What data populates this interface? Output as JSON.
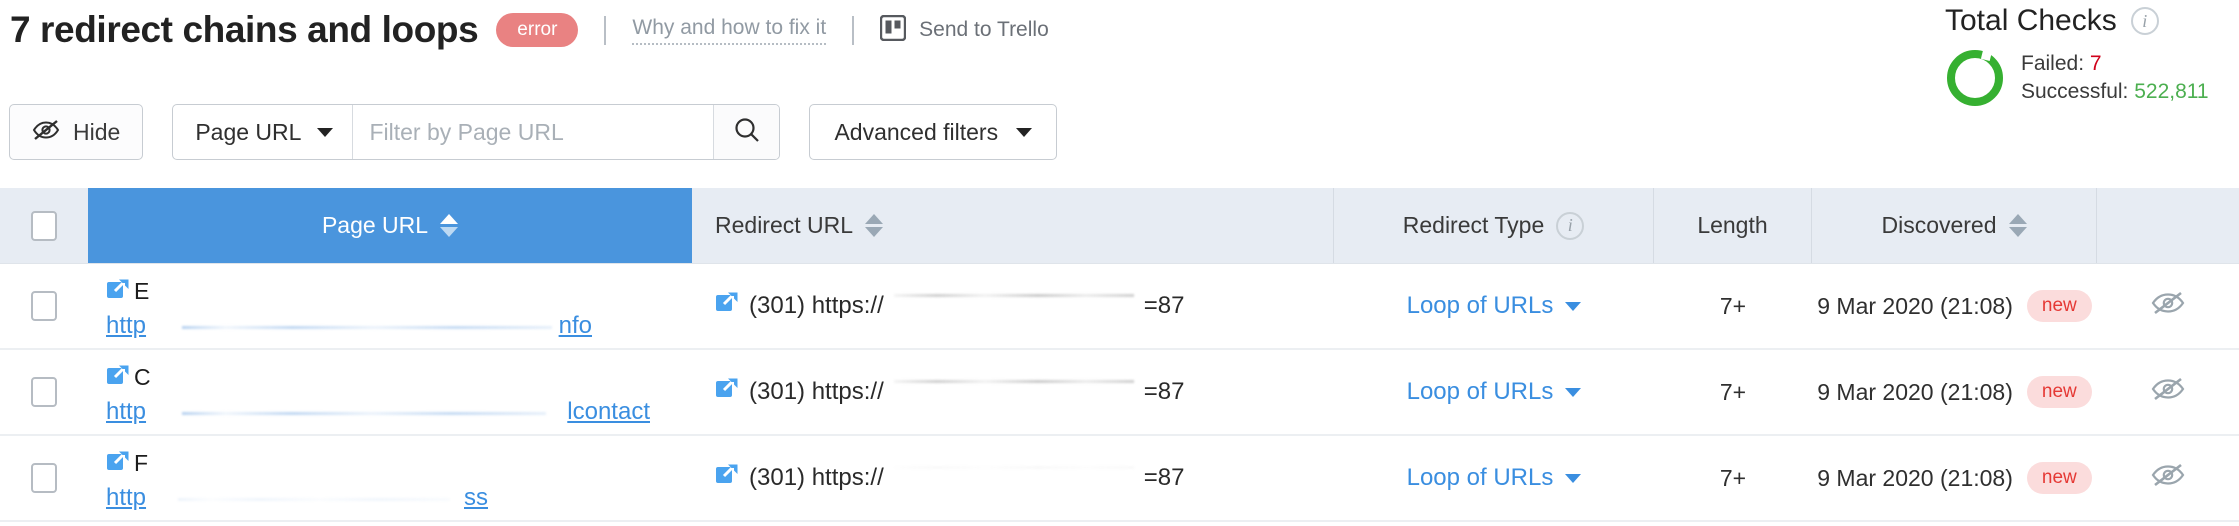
{
  "header": {
    "title": "7 redirect chains and loops",
    "error_badge": "error",
    "why_link": "Why and how to fix it",
    "trello_label": "Send to Trello",
    "trello_icon": "trello-board-icon"
  },
  "checks": {
    "title": "Total Checks",
    "info_icon": "info-icon",
    "failed_label": "Failed:",
    "failed_value": "7",
    "successful_label": "Successful:",
    "successful_value": "522,811",
    "failed_color": "#d0021b",
    "successful_color": "#4caf50",
    "donut_color": "#36b031"
  },
  "filters": {
    "hide_label": "Hide",
    "hide_icon": "eye-slash-icon",
    "select_value": "Page URL",
    "search_placeholder": "Filter by Page URL",
    "search_value": "",
    "search_icon": "search-icon",
    "advanced_label": "Advanced filters"
  },
  "table": {
    "columns": [
      {
        "key": "select",
        "label": "",
        "sortable": false
      },
      {
        "key": "page_url",
        "label": "Page URL",
        "sortable": true,
        "active": true
      },
      {
        "key": "redirect_url",
        "label": "Redirect URL",
        "sortable": true
      },
      {
        "key": "redirect_type",
        "label": "Redirect Type",
        "sortable": false,
        "info": true
      },
      {
        "key": "length",
        "label": "Length",
        "sortable": false
      },
      {
        "key": "discovered",
        "label": "Discovered",
        "sortable": true
      },
      {
        "key": "actions",
        "label": "",
        "sortable": false
      }
    ],
    "active_column_color": "#4a95dd",
    "rows": [
      {
        "page_title": "E",
        "page_url_head": "http",
        "page_url_tail": "nfo",
        "redirect_text": "(301) https://",
        "redirect_suffix": "=87",
        "redirect_type": "Loop of URLs",
        "length": "7+",
        "discovered": "9 Mar 2020 (21:08)",
        "badge": "new",
        "hide_icon": "eye-slash-icon"
      },
      {
        "page_title": "C",
        "page_url_head": "http",
        "page_url_tail": "lcontact",
        "redirect_text": "(301) https://",
        "redirect_suffix": "=87",
        "redirect_type": "Loop of URLs",
        "length": "7+",
        "discovered": "9 Mar 2020 (21:08)",
        "badge": "new",
        "hide_icon": "eye-slash-icon"
      },
      {
        "page_title": "F",
        "page_url_head": "http",
        "page_url_tail": "ss",
        "redirect_text": "(301) https://",
        "redirect_suffix": "=87",
        "redirect_type": "Loop of URLs",
        "length": "7+",
        "discovered": "9 Mar 2020 (21:08)",
        "badge": "new",
        "hide_icon": "eye-slash-icon"
      }
    ]
  }
}
